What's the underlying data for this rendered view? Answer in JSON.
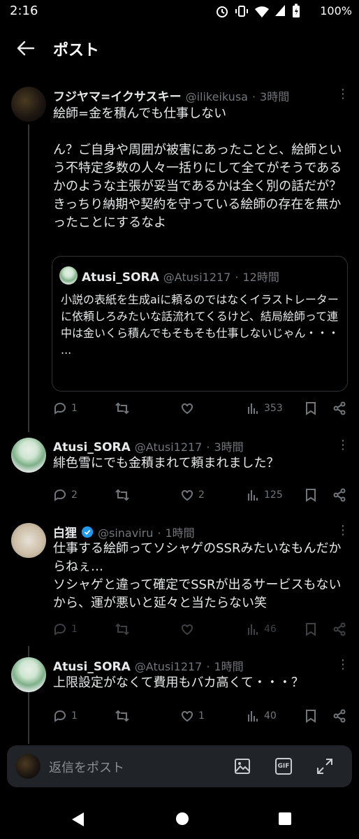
{
  "status_bar": {
    "time": "2:16",
    "battery": "100%"
  },
  "header": {
    "title": "ポスト"
  },
  "main_post": {
    "name": "フジヤマ=イクサスキー",
    "handle": "@ilikeikusa",
    "time": "3時間",
    "text": "絵師=金を積んでも仕事しない\n\nん？ご自身や周囲が被害にあったことと、絵師という不特定多数の人々一括りにして全てがそうであるかのような主張が妥当であるかは全く別の話だが？\nきっちり納期や契約を守っている絵師の存在を無かったことにするなよ",
    "quote": {
      "name": "Atusi_SORA",
      "handle": "@Atusi1217",
      "time": "12時間",
      "text": "小説の表紙を生成aiに頼るのではなくイラストレーターに依頼しろみたいな話流れてくるけど、結局絵師って連中は金いくら積んでもそもそも仕事しないじゃん・・・\n..."
    },
    "stats": {
      "replies": "1",
      "retweets": "",
      "likes": "",
      "views": "353"
    }
  },
  "replies": [
    {
      "name": "Atusi_SORA",
      "handle": "@Atusi1217",
      "time": "3時間",
      "text": "緋色雪にでも金積まれて頼まれました？",
      "stats": {
        "replies": "2",
        "retweets": "",
        "likes": "2",
        "views": "125"
      }
    },
    {
      "name": "白狸",
      "handle": "@sinaviru",
      "time": "1時間",
      "text": "仕事する絵師ってソシャゲのSSRみたいなもんだからねぇ…\nソシャゲと違って確定でSSRが出るサービスもないから、運が悪いと延々と当たらない笑",
      "stats": {
        "replies": "1",
        "retweets": "",
        "likes": "",
        "views": "46"
      }
    },
    {
      "name": "Atusi_SORA",
      "handle": "@Atusi1217",
      "time": "1時間",
      "text": "上限設定がなくて費用もバカ高くて・・・？",
      "stats": {
        "replies": "1",
        "retweets": "",
        "likes": "1",
        "views": "40"
      }
    }
  ],
  "composer": {
    "placeholder": "返信をポスト",
    "gif_label": "GIF"
  },
  "colors": {
    "background": "#000000",
    "text": "#e7e9ea",
    "muted": "#71767b",
    "verified": "#1d9bf0"
  }
}
